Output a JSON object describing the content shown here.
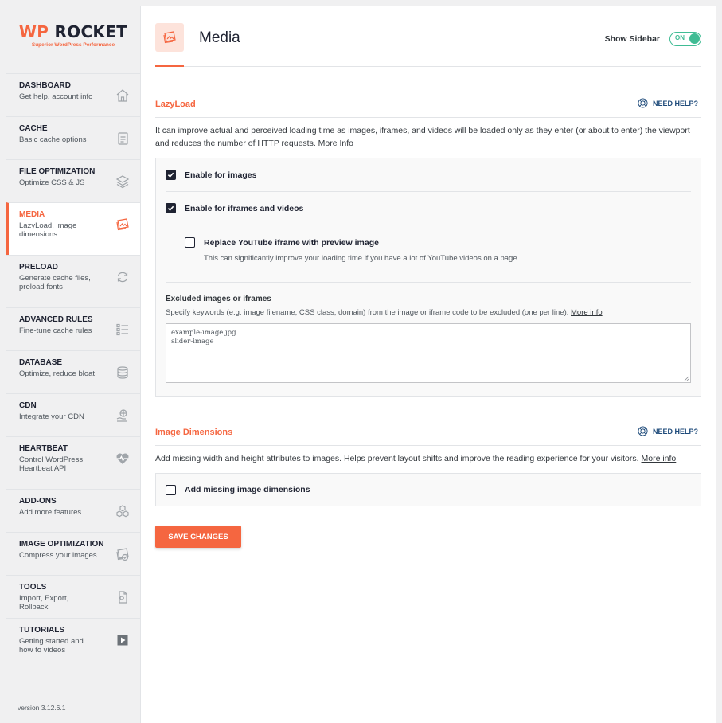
{
  "brand": {
    "title_wp": "WP",
    "title_rest": " ROCKET",
    "tagline": "Superior WordPress Performance"
  },
  "sidebar": {
    "items": [
      {
        "title": "DASHBOARD",
        "desc": "Get help, account info",
        "icon": "home-icon"
      },
      {
        "title": "CACHE",
        "desc": "Basic cache options",
        "icon": "page-icon"
      },
      {
        "title": "FILE OPTIMIZATION",
        "desc": "Optimize CSS & JS",
        "icon": "layers-icon"
      },
      {
        "title": "MEDIA",
        "desc": "LazyLoad, image dimensions",
        "icon": "media-icon"
      },
      {
        "title": "PRELOAD",
        "desc": "Generate cache files, preload fonts",
        "icon": "refresh-icon"
      },
      {
        "title": "ADVANCED RULES",
        "desc": "Fine-tune cache rules",
        "icon": "list-icon"
      },
      {
        "title": "DATABASE",
        "desc": "Optimize, reduce bloat",
        "icon": "database-icon"
      },
      {
        "title": "CDN",
        "desc": "Integrate your CDN",
        "icon": "cdn-icon"
      },
      {
        "title": "HEARTBEAT",
        "desc": "Control WordPress Heartbeat API",
        "icon": "heartbeat-icon"
      },
      {
        "title": "ADD-ONS",
        "desc": "Add more features",
        "icon": "addons-icon"
      },
      {
        "title": "IMAGE OPTIMIZATION",
        "desc": "Compress your images",
        "icon": "image-icon"
      },
      {
        "title": "TOOLS",
        "desc": "Import, Export, Rollback",
        "icon": "tools-icon"
      },
      {
        "title": "TUTORIALS",
        "desc": "Getting started and how to videos",
        "icon": "play-icon"
      }
    ],
    "version": "version 3.12.6.1"
  },
  "header": {
    "title": "Media",
    "show_sidebar_label": "Show Sidebar",
    "toggle_label": "ON"
  },
  "lazyload": {
    "title": "LazyLoad",
    "need_help": "NEED HELP?",
    "desc": "It can improve actual and perceived loading time as images, iframes, and videos will be loaded only as they enter (or about to enter) the viewport and reduces the number of HTTP requests.",
    "more_info": "More Info",
    "opt_images": "Enable for images",
    "opt_iframes": "Enable for iframes and videos",
    "opt_youtube": "Replace YouTube iframe with preview image",
    "opt_youtube_desc": "This can significantly improve your loading time if you have a lot of YouTube videos on a page.",
    "excluded_title": "Excluded images or iframes",
    "excluded_desc": "Specify keywords (e.g. image filename, CSS class, domain) from the image or iframe code to be excluded (one per line).",
    "excluded_more": "More info",
    "excluded_lines": [
      "example-image.jpg",
      "slider-image"
    ]
  },
  "dimensions": {
    "title": "Image Dimensions",
    "need_help": "NEED HELP?",
    "desc": "Add missing width and height attributes to images. Helps prevent layout shifts and improve the reading experience for your visitors.",
    "more_info": "More info",
    "opt_label": "Add missing image dimensions"
  },
  "save_label": "SAVE CHANGES",
  "colors": {
    "accent": "#f56640",
    "toggle": "#40bc94",
    "dark": "#1f2332"
  }
}
